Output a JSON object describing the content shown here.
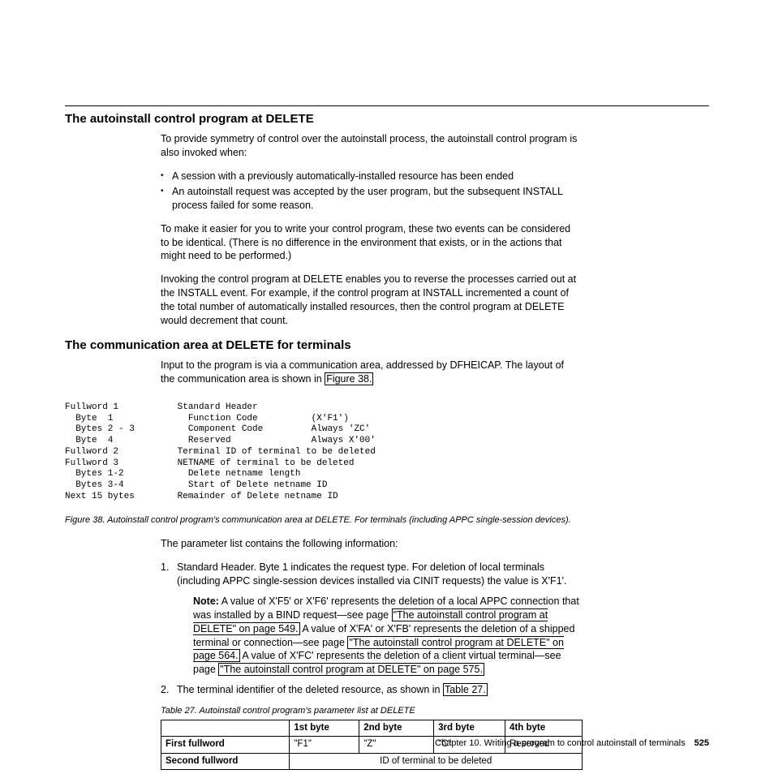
{
  "section1": {
    "title": "The autoinstall control program at DELETE",
    "para1": "To provide symmetry of control over the autoinstall process, the autoinstall control program is also invoked when:",
    "bullet1": "A session with a previously automatically-installed resource has been ended",
    "bullet2": "An autoinstall request was accepted by the user program, but the subsequent INSTALL process failed for some reason.",
    "para2": "To make it easier for you to write your control program, these two events can be considered to be identical. (There is no difference in the environment that exists, or in the actions that might need to be performed.)",
    "para3": "Invoking the control program at DELETE enables you to reverse the processes carried out at the INSTALL event. For example, if the control program at INSTALL incremented a count of the total number of automatically installed resources, then the control program at DELETE would decrement that count."
  },
  "section2": {
    "title": "The communication area at DELETE for terminals",
    "para1a": "Input to the program is via a communication area, addressed by DFHEICAP. The layout of the communication area is shown in ",
    "link1": "Figure 38.",
    "figtext": "Fullword 1           Standard Header\n  Byte  1              Function Code          (X'F1')\n  Bytes 2 - 3          Component Code         Always 'ZC'\n  Byte  4              Reserved               Always X'00'\nFullword 2           Terminal ID of terminal to be deleted\nFullword 3           NETNAME of terminal to be deleted\n  Bytes 1-2            Delete netname length\n  Bytes 3-4            Start of Delete netname ID\nNext 15 bytes        Remainder of Delete netname ID",
    "figcap": "Figure 38. Autoinstall control program's communication area at DELETE. For terminals (including APPC single-session devices).",
    "paramlead": "The parameter list contains the following information:",
    "li1": "Standard Header. Byte 1 indicates the request type. For deletion of local terminals (including APPC single-session devices installed via CINIT requests) the value is X'F1'.",
    "note_label": "Note:",
    "note_t1": " A value of X'F5' or X'F6' represents the deletion of a local APPC connection that was installed by a BIND request—see page ",
    "note_l1": "\"The autoinstall control program at DELETE\" on page 549.",
    "note_t2": " A value of X'FA' or X'FB' represents the deletion of a shipped terminal or connection—see page ",
    "note_l2": "\"The autoinstall control program at DELETE\" on page 564.",
    "note_t3": " A value of X'FC' represents the deletion of a client virtual terminal—see page ",
    "note_l3": "\"The autoinstall control program at DELETE\" on page 575.",
    "li2a": "The terminal identifier of the deleted resource, as shown in ",
    "li2link": "Table 27.",
    "tablecap": "Table 27. Autoinstall control program's parameter list at DELETE",
    "table": {
      "head": [
        "",
        "1st byte",
        "2nd byte",
        "3rd byte",
        "4th byte"
      ],
      "row1": [
        "First fullword",
        "\"F1\"",
        "\"Z\"",
        "\"C\"",
        "Reserved"
      ],
      "row2label": "Second fullword",
      "row2span": "ID of terminal to be deleted"
    }
  },
  "footer": {
    "chapter": "Chapter 10. Writing a program to control autoinstall of terminals",
    "page": "525"
  }
}
